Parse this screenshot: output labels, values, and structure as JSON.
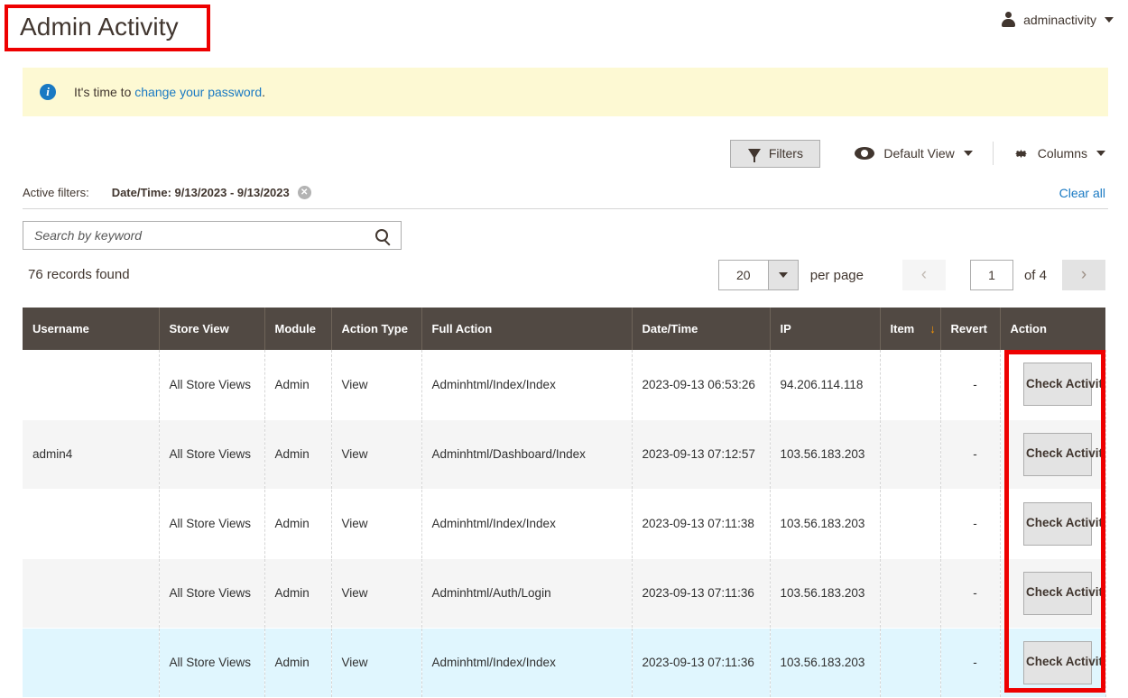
{
  "header": {
    "title": "Admin Activity",
    "user_name": "adminactivity",
    "avatar_icon": "user-avatar-icon",
    "caret_icon": "chevron-down-icon"
  },
  "notice": {
    "icon": "info-icon",
    "icon_glyph": "i",
    "text_before": "It's time to ",
    "link_text": "change your password",
    "text_after": "."
  },
  "toolbar": {
    "filters_label": "Filters",
    "filters_icon": "funnel-icon",
    "view_label": "Default View",
    "view_icon": "eye-icon",
    "columns_label": "Columns",
    "columns_icon": "gear-icon",
    "caret_icon": "chevron-down-icon"
  },
  "active_filters": {
    "label": "Active filters:",
    "chips": [
      {
        "text": "Date/Time: 9/13/2023 - 9/13/2023",
        "remove_glyph": "✕"
      }
    ],
    "clear_all": "Clear all"
  },
  "search": {
    "placeholder": "Search by keyword",
    "value": "",
    "icon": "search-icon"
  },
  "listing": {
    "records_found": "76 records found",
    "per_page_value": "20",
    "per_page_label": "per page",
    "prev_glyph": "‹",
    "next_glyph": "›",
    "page_value": "1",
    "of_label": "of 4"
  },
  "table": {
    "columns": [
      "Username",
      "Store View",
      "Module",
      "Action Type",
      "Full Action",
      "Date/Time",
      "IP",
      "Item",
      "Revert",
      "Action"
    ],
    "sort_column": "Item",
    "sort_glyph": "↓",
    "action_button_label": "Check Activity",
    "rows": [
      {
        "username": "",
        "store_view": "All Store Views",
        "module": "Admin",
        "action_type": "View",
        "full_action": "Adminhtml/Index/Index",
        "datetime": "2023-09-13 06:53:26",
        "ip": "94.206.114.118",
        "item": "",
        "revert": "-",
        "style": "odd"
      },
      {
        "username": "admin4",
        "store_view": "All Store Views",
        "module": "Admin",
        "action_type": "View",
        "full_action": "Adminhtml/Dashboard/Index",
        "datetime": "2023-09-13 07:12:57",
        "ip": "103.56.183.203",
        "item": "",
        "revert": "-",
        "style": "even"
      },
      {
        "username": "",
        "store_view": "All Store Views",
        "module": "Admin",
        "action_type": "View",
        "full_action": "Adminhtml/Index/Index",
        "datetime": "2023-09-13 07:11:38",
        "ip": "103.56.183.203",
        "item": "",
        "revert": "-",
        "style": "odd"
      },
      {
        "username": "",
        "store_view": "All Store Views",
        "module": "Admin",
        "action_type": "View",
        "full_action": "Adminhtml/Auth/Login",
        "datetime": "2023-09-13 07:11:36",
        "ip": "103.56.183.203",
        "item": "",
        "revert": "-",
        "style": "even"
      },
      {
        "username": "",
        "store_view": "All Store Views",
        "module": "Admin",
        "action_type": "View",
        "full_action": "Adminhtml/Index/Index",
        "datetime": "2023-09-13 07:11:36",
        "ip": "103.56.183.203",
        "item": "",
        "revert": "-",
        "style": "selected"
      }
    ]
  },
  "colors": {
    "highlight": "#ee0000",
    "header_bg": "#514943",
    "notice_bg": "#fdf9d3",
    "link": "#1979c3",
    "selected_row": "#e0f6fe",
    "sort_arrow": "#ff9800"
  }
}
